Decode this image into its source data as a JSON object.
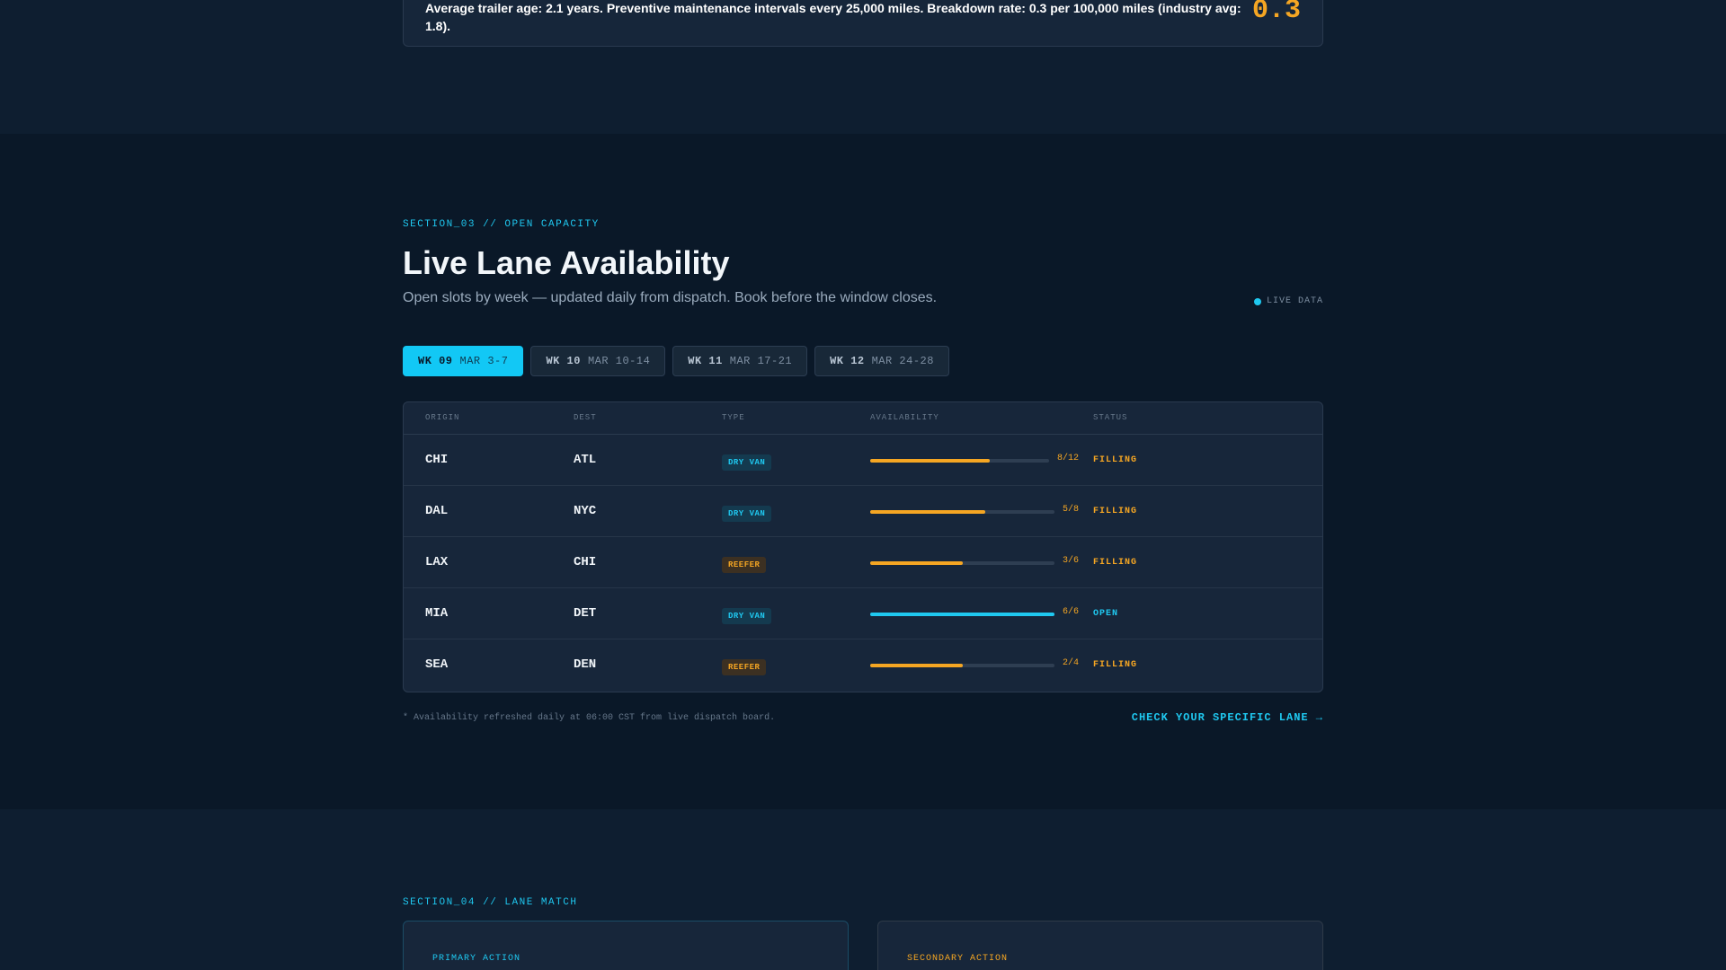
{
  "top_card": {
    "text": "Average trailer age: 2.1 years. Preventive maintenance intervals every 25,000 miles. Breakdown rate: 0.3 per 100,000 miles (industry avg: 1.8).",
    "big_value": "0.3"
  },
  "section3": {
    "eyebrow": "SECTION_03 // OPEN CAPACITY",
    "title": "Live Lane Availability",
    "subtitle": "Open slots by week — updated daily from dispatch. Book before the window closes.",
    "live_label": "LIVE DATA",
    "tabs": [
      {
        "wk": "WK 09",
        "dates": "MAR 3-7"
      },
      {
        "wk": "WK 10",
        "dates": "MAR 10-14"
      },
      {
        "wk": "WK 11",
        "dates": "MAR 17-21"
      },
      {
        "wk": "WK 12",
        "dates": "MAR 24-28"
      }
    ],
    "headers": {
      "origin": "ORIGIN",
      "dest": "DEST",
      "type": "TYPE",
      "availability": "AVAILABILITY",
      "status": "STATUS"
    },
    "rows": [
      {
        "origin": "CHI",
        "dest": "ATL",
        "type": "DRY VAN",
        "booked": 8,
        "total": 12,
        "count": "8/12",
        "status": "FILLING"
      },
      {
        "origin": "DAL",
        "dest": "NYC",
        "type": "DRY VAN",
        "booked": 5,
        "total": 8,
        "count": "5/8",
        "status": "FILLING"
      },
      {
        "origin": "LAX",
        "dest": "CHI",
        "type": "REEFER",
        "booked": 3,
        "total": 6,
        "count": "3/6",
        "status": "FILLING"
      },
      {
        "origin": "MIA",
        "dest": "DET",
        "type": "DRY VAN",
        "booked": 6,
        "total": 6,
        "count": "6/6",
        "status": "OPEN"
      },
      {
        "origin": "SEA",
        "dest": "DEN",
        "type": "REEFER",
        "booked": 2,
        "total": 4,
        "count": "2/4",
        "status": "FILLING"
      }
    ],
    "note": "* Availability refreshed daily at 06:00 CST from live dispatch board.",
    "cta": "CHECK YOUR SPECIFIC LANE →"
  },
  "section4": {
    "eyebrow": "SECTION_04 // LANE MATCH",
    "primary_label": "PRIMARY ACTION",
    "secondary_label": "SECONDARY ACTION"
  },
  "colors": {
    "accent": "#1fc8f0",
    "amber": "#f5a623",
    "background": "#0a1828"
  }
}
